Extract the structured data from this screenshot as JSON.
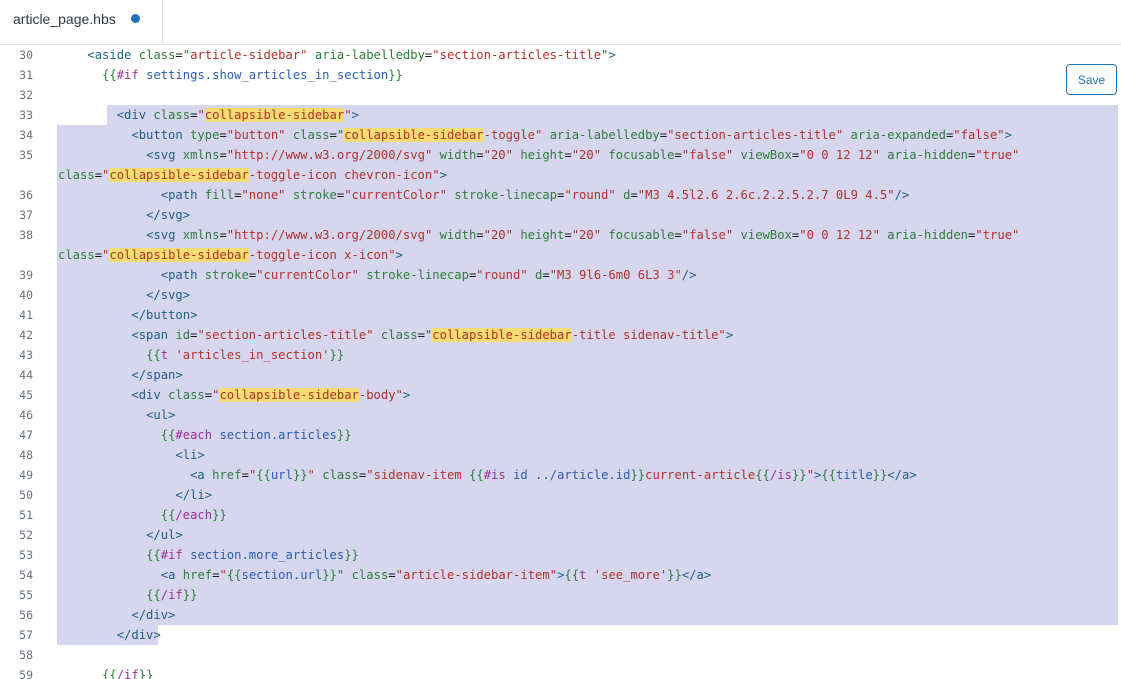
{
  "tab": {
    "filename": "article_page.hbs"
  },
  "toolbar": {
    "save_label": "Save"
  },
  "editor": {
    "lines": [
      {
        "n": "30",
        "code": "    <span class=\"t\">&lt;aside</span> <span class=\"a\">class</span>=<span class=\"s\">\"article-sidebar\"</span> <span class=\"a\">aria-labelledby</span>=<span class=\"s\">\"section-articles-title\"</span><span class=\"t\">&gt;</span>"
      },
      {
        "n": "31",
        "code": "      <span class=\"hb\">{{</span><span class=\"kw\">#if</span> <span class=\"hv\">settings.show_articles_in_section</span><span class=\"hb\">}}</span>"
      },
      {
        "n": "32",
        "code": ""
      },
      {
        "n": "33",
        "code": "        <span class=\"t\">&lt;div</span> <span class=\"a\">class</span>=<span class=\"s\">\"<span class=\"hl\">collapsible-sidebar</span>\"</span><span class=\"t\">&gt;</span>"
      },
      {
        "n": "34",
        "code": "          <span class=\"t\">&lt;button</span> <span class=\"a\">type</span>=<span class=\"s\">\"button\"</span> <span class=\"a\">class</span>=<span class=\"s\">\"<span class=\"hl\">collapsible-sidebar</span>-toggle\"</span> <span class=\"a\">aria-labelledby</span>=<span class=\"s\">\"section-articles-title\"</span> <span class=\"a\">aria-expanded</span>=<span class=\"s\">\"false\"</span><span class=\"t\">&gt;</span>"
      },
      {
        "n": "35",
        "code": "            <span class=\"t\">&lt;svg</span> <span class=\"a\">xmlns</span>=<span class=\"s\">\"http://www.w3.org/2000/svg\"</span> <span class=\"a\">width</span>=<span class=\"s\">\"20\"</span> <span class=\"a\">height</span>=<span class=\"s\">\"20\"</span> <span class=\"a\">focusable</span>=<span class=\"s\">\"false\"</span> <span class=\"a\">viewBox</span>=<span class=\"s\">\"0 0 12 12\"</span> <span class=\"a\">aria-hidden</span>=<span class=\"s\">\"true\"</span>"
      },
      {
        "n": "",
        "code": "<span class=\"a\">class</span>=<span class=\"s\">\"<span class=\"hl\">collapsible-sidebar</span>-toggle-icon chevron-icon\"</span><span class=\"t\">&gt;</span>"
      },
      {
        "n": "36",
        "code": "              <span class=\"t\">&lt;path</span> <span class=\"a\">fill</span>=<span class=\"s\">\"none\"</span> <span class=\"a\">stroke</span>=<span class=\"s\">\"currentColor\"</span> <span class=\"a\">stroke-linecap</span>=<span class=\"s\">\"round\"</span> <span class=\"a\">d</span>=<span class=\"s\">\"M3 4.5l2.6 2.6c.2.2.5.2.7 0L9 4.5\"</span><span class=\"t\">/&gt;</span>"
      },
      {
        "n": "37",
        "code": "            <span class=\"t\">&lt;/svg&gt;</span>"
      },
      {
        "n": "38",
        "code": "            <span class=\"t\">&lt;svg</span> <span class=\"a\">xmlns</span>=<span class=\"s\">\"http://www.w3.org/2000/svg\"</span> <span class=\"a\">width</span>=<span class=\"s\">\"20\"</span> <span class=\"a\">height</span>=<span class=\"s\">\"20\"</span> <span class=\"a\">focusable</span>=<span class=\"s\">\"false\"</span> <span class=\"a\">viewBox</span>=<span class=\"s\">\"0 0 12 12\"</span> <span class=\"a\">aria-hidden</span>=<span class=\"s\">\"true\"</span>"
      },
      {
        "n": "",
        "code": "<span class=\"a\">class</span>=<span class=\"s\">\"<span class=\"hl\">collapsible-sidebar</span>-toggle-icon x-icon\"</span><span class=\"t\">&gt;</span>"
      },
      {
        "n": "39",
        "code": "              <span class=\"t\">&lt;path</span> <span class=\"a\">stroke</span>=<span class=\"s\">\"currentColor\"</span> <span class=\"a\">stroke-linecap</span>=<span class=\"s\">\"round\"</span> <span class=\"a\">d</span>=<span class=\"s\">\"M3 9l6-6m0 6L3 3\"</span><span class=\"t\">/&gt;</span>"
      },
      {
        "n": "40",
        "code": "            <span class=\"t\">&lt;/svg&gt;</span>"
      },
      {
        "n": "41",
        "code": "          <span class=\"t\">&lt;/button&gt;</span>"
      },
      {
        "n": "42",
        "code": "          <span class=\"t\">&lt;span</span> <span class=\"a\">id</span>=<span class=\"s\">\"section-articles-title\"</span> <span class=\"a\">class</span>=<span class=\"s\">\"<span class=\"hl\">collapsible-sidebar</span>-title sidenav-title\"</span><span class=\"t\">&gt;</span>"
      },
      {
        "n": "43",
        "code": "            <span class=\"hb\">{{</span><span class=\"kw\">t</span> <span class=\"s\">'articles_in_section'</span><span class=\"hb\">}}</span>"
      },
      {
        "n": "44",
        "code": "          <span class=\"t\">&lt;/span&gt;</span>"
      },
      {
        "n": "45",
        "code": "          <span class=\"t\">&lt;div</span> <span class=\"a\">class</span>=<span class=\"s\">\"<span class=\"hl\">collapsible-sidebar</span>-body\"</span><span class=\"t\">&gt;</span>"
      },
      {
        "n": "46",
        "code": "            <span class=\"t\">&lt;ul&gt;</span>"
      },
      {
        "n": "47",
        "code": "              <span class=\"hb\">{{</span><span class=\"kw\">#each</span> <span class=\"hv\">section.articles</span><span class=\"hb\">}}</span>"
      },
      {
        "n": "48",
        "code": "                <span class=\"t\">&lt;li&gt;</span>"
      },
      {
        "n": "49",
        "code": "                  <span class=\"t\">&lt;a</span> <span class=\"a\">href</span>=<span class=\"s\">\"</span><span class=\"hb\">{{</span><span class=\"hv\">url</span><span class=\"hb\">}}</span><span class=\"s\">\"</span> <span class=\"a\">class</span>=<span class=\"s\">\"sidenav-item </span><span class=\"hb\">{{</span><span class=\"kw\">#is</span> <span class=\"hv\">id ../article.id</span><span class=\"hb\">}}</span><span class=\"s\">current-article</span><span class=\"hb\">{{</span><span class=\"kw\">/is</span><span class=\"hb\">}}</span><span class=\"s\">\"</span><span class=\"t\">&gt;</span><span class=\"hb\">{{</span><span class=\"hv\">title</span><span class=\"hb\">}}</span><span class=\"t\">&lt;/a&gt;</span>"
      },
      {
        "n": "50",
        "code": "                <span class=\"t\">&lt;/li&gt;</span>"
      },
      {
        "n": "51",
        "code": "              <span class=\"hb\">{{</span><span class=\"kw\">/each</span><span class=\"hb\">}}</span>"
      },
      {
        "n": "52",
        "code": "            <span class=\"t\">&lt;/ul&gt;</span>"
      },
      {
        "n": "53",
        "code": "            <span class=\"hb\">{{</span><span class=\"kw\">#if</span> <span class=\"hv\">section.more_articles</span><span class=\"hb\">}}</span>"
      },
      {
        "n": "54",
        "code": "              <span class=\"t\">&lt;a</span> <span class=\"a\">href</span>=<span class=\"s\">\"</span><span class=\"hb\">{{</span><span class=\"hv\">section.url</span><span class=\"hb\">}}</span><span class=\"s\">\"</span> <span class=\"a\">class</span>=<span class=\"s\">\"article-sidebar-item\"</span><span class=\"t\">&gt;</span><span class=\"hb\">{{</span><span class=\"kw\">t</span> <span class=\"s\">'see_more'</span><span class=\"hb\">}}</span><span class=\"t\">&lt;/a&gt;</span>"
      },
      {
        "n": "55",
        "code": "            <span class=\"hb\">{{</span><span class=\"kw\">/if</span><span class=\"hb\">}}</span>"
      },
      {
        "n": "56",
        "code": "          <span class=\"t\">&lt;/div&gt;</span>"
      },
      {
        "n": "57",
        "code": "        <span class=\"t\">&lt;/div&gt;</span>"
      },
      {
        "n": "58",
        "code": ""
      },
      {
        "n": "59",
        "code": "      <span class=\"hb\">{{</span><span class=\"kw\">/if</span><span class=\"hb\">}}</span>"
      }
    ]
  },
  "colors": {
    "accent": "#1f73b7",
    "selection": "#d6d6ee",
    "match_highlight": "#f5dc73",
    "unsaved_dot": "#1f73b7"
  }
}
